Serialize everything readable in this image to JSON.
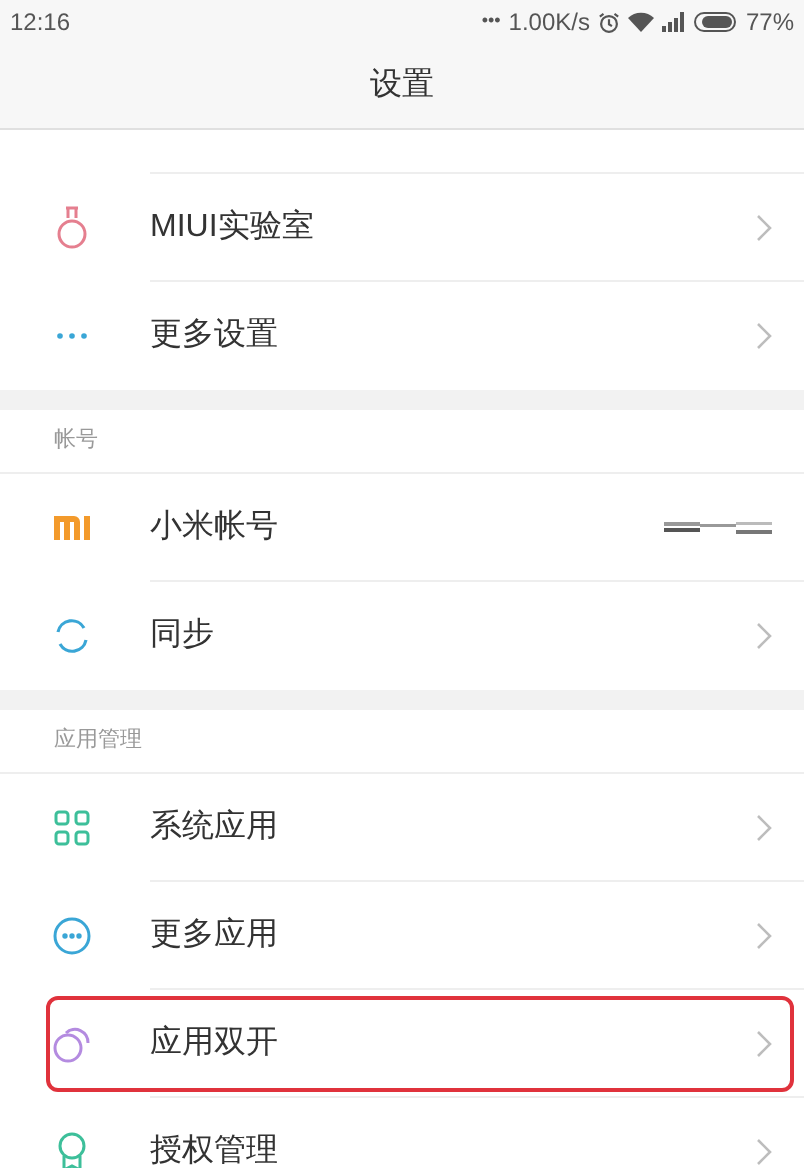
{
  "status_bar": {
    "time": "12:16",
    "more": "•••",
    "speed": "1.00K/s",
    "battery": "77%"
  },
  "header": {
    "title": "设置"
  },
  "sections": [
    {
      "items": [
        {
          "kind": "link",
          "label": "MIUI实验室",
          "highlighted": false
        },
        {
          "kind": "link",
          "label": "更多设置",
          "highlighted": false
        }
      ]
    },
    {
      "title": "帐号",
      "items": [
        {
          "kind": "account",
          "label": "小米帐号",
          "highlighted": false
        },
        {
          "kind": "link",
          "label": "同步",
          "highlighted": false
        }
      ]
    },
    {
      "title": "应用管理",
      "items": [
        {
          "kind": "link",
          "label": "系统应用",
          "highlighted": false
        },
        {
          "kind": "link",
          "label": "更多应用",
          "highlighted": false
        },
        {
          "kind": "link",
          "label": "应用双开",
          "highlighted": true
        },
        {
          "kind": "link",
          "label": "授权管理",
          "highlighted": false
        }
      ]
    }
  ]
}
